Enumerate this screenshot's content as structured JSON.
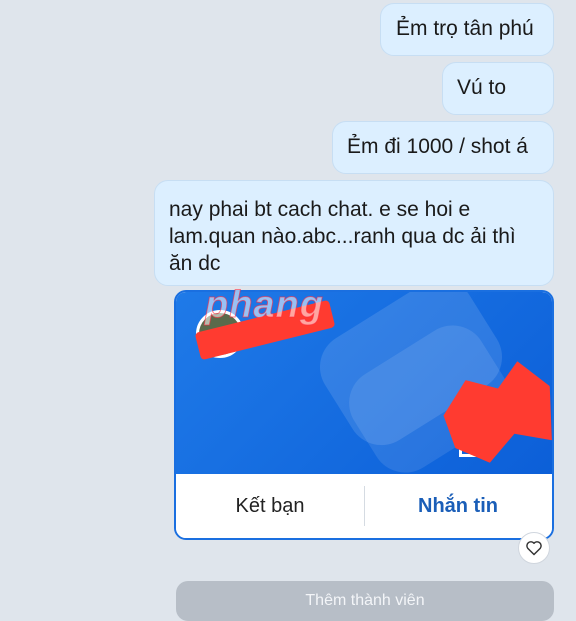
{
  "messages": [
    {
      "text": "Ẻm trọ tân phú"
    },
    {
      "text": "Vú to"
    },
    {
      "text": "Ẻm đi 1000 / shot á"
    },
    {
      "text": "nay phai bt cach chat. e se hoi e lam.quan nào.abc...ranh qua dc ải thì ăn dc"
    }
  ],
  "contact_card": {
    "add_friend_label": "Kết bạn",
    "message_label": "Nhắn tin",
    "icons": [
      "avatar",
      "qr-code-icon"
    ]
  },
  "watermark": "phang",
  "reaction": {
    "icon": "heart-icon"
  },
  "footer": {
    "add_member_label": "Thêm thành viên"
  },
  "colors": {
    "bubble": "#dcefff",
    "card_blue": "#1270e4",
    "accent_text": "#1a5eb8",
    "redaction": "#ff3b30"
  }
}
